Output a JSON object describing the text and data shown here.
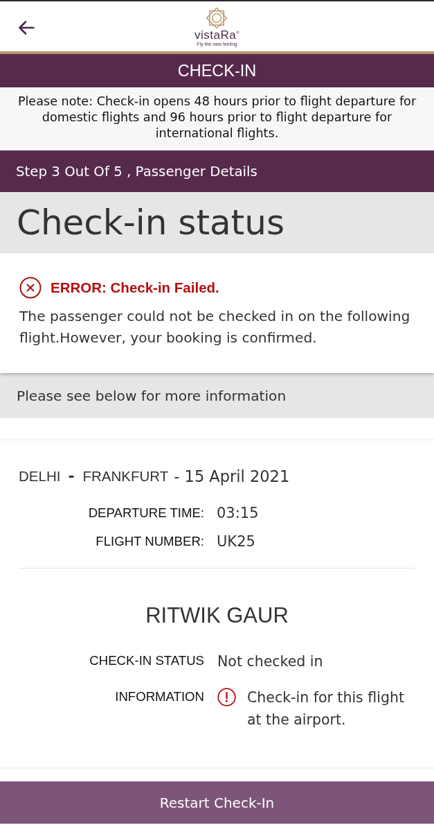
{
  "header": {
    "logo": {
      "brand": "vistaRa",
      "mark": "®",
      "tagline": "Fly the new feeling"
    }
  },
  "title_bar": {
    "title": "CHECK-IN"
  },
  "notice": "Please note: Check-in opens 48 hours prior to flight departure for domestic flights and 96 hours prior to flight departure for international flights.",
  "step_bar": {
    "text": "Step 3 Out Of 5 , Passenger Details"
  },
  "page_heading": "Check-in status",
  "alert": {
    "kind": "error",
    "title": "ERROR: Check-in Failed.",
    "message": "The passenger could not be checked in on the following flight.However, your booking is confirmed."
  },
  "info_bar": "Please see below for more information",
  "flight": {
    "origin": "DELHI",
    "separator": "-",
    "destination": "FRANKFURT",
    "date": "- 15 April 2021",
    "details": [
      {
        "label": "DEPARTURE TIME:",
        "value": "03:15"
      },
      {
        "label": "FLIGHT NUMBER:",
        "value": "UK25"
      }
    ]
  },
  "passenger": {
    "name": "RITWIK GAUR",
    "fields": [
      {
        "kind": "text",
        "label": "CHECK-IN STATUS",
        "value": "Not checked in"
      },
      {
        "kind": "warning",
        "label": "INFORMATION",
        "value": "Check-in for this flight at the airport."
      }
    ]
  },
  "buttons": [
    {
      "label": "Restart Check-In"
    }
  ]
}
